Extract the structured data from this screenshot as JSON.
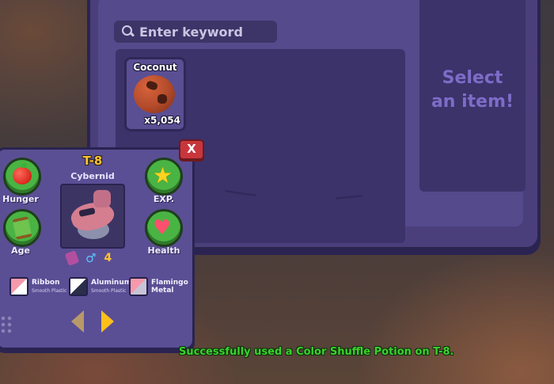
{
  "inventory": {
    "search": {
      "placeholder": "Enter keyword"
    },
    "items": [
      {
        "name": "Coconut",
        "count": "x5,054",
        "icon": "coconut-icon"
      }
    ],
    "detail_placeholder": "Select\nan item!"
  },
  "pet": {
    "name": "T-8",
    "species": "Cybernid",
    "close_label": "X",
    "stats": {
      "hunger": "Hunger",
      "age": "Age",
      "exp": "EXP.",
      "health": "Health"
    },
    "level": "4",
    "gender_icon": "male-icon",
    "colors": [
      {
        "name": "Ribbon",
        "material": "Smooth Plastic",
        "color_a": "#f59aac",
        "color_b": "#ffffff"
      },
      {
        "name": "Aluminum",
        "material": "Smooth Plastic",
        "color_a": "#ffffff",
        "color_b": "#2b2e48"
      },
      {
        "name": "Flamingo",
        "material": "Metal",
        "color_a": "#f59aac",
        "color_b": "#c8c4d8"
      }
    ]
  },
  "status_message": "Successfully used a Color Shuffle Potion on T-8.",
  "colors": {
    "panel": "#554a8c",
    "panel_dark": "#3b336a",
    "stat_green": "#49b443",
    "accent_gold": "#ffc233",
    "success_green": "#3bd12e",
    "close_red": "#c8363c"
  }
}
